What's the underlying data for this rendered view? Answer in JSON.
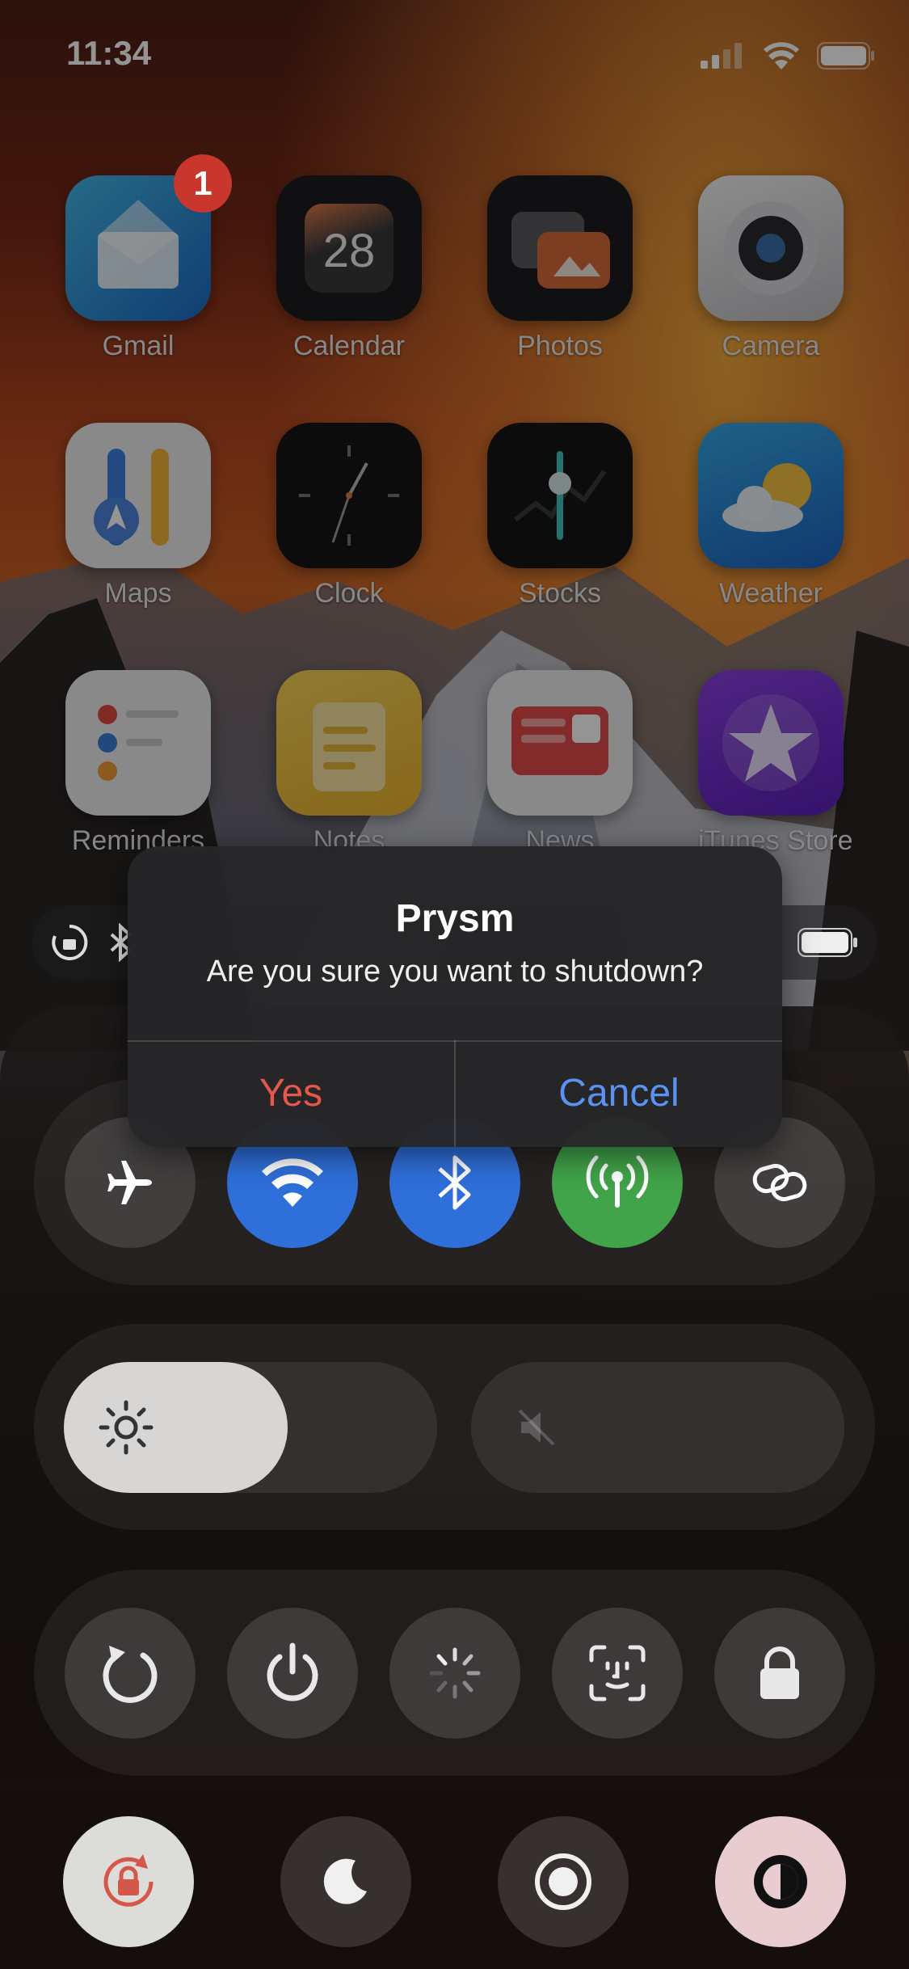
{
  "status_bar": {
    "time": "11:34"
  },
  "apps": [
    {
      "name": "Gmail",
      "badge": "1"
    },
    {
      "name": "Calendar",
      "date": "28"
    },
    {
      "name": "Photos"
    },
    {
      "name": "Camera"
    },
    {
      "name": "Maps"
    },
    {
      "name": "Clock"
    },
    {
      "name": "Stocks"
    },
    {
      "name": "Weather"
    },
    {
      "name": "Reminders"
    },
    {
      "name": "Notes"
    },
    {
      "name": "News"
    },
    {
      "name": "iTunes Store"
    }
  ],
  "alert": {
    "title": "Prysm",
    "message": "Are you sure you want to shutdown?",
    "confirm_label": "Yes",
    "cancel_label": "Cancel",
    "confirm_color": "#e4574a",
    "cancel_color": "#5b92f0"
  },
  "connectivity": {
    "airplane": {
      "icon": "airplane-icon",
      "on": false
    },
    "wifi": {
      "icon": "wifi-icon",
      "on": true,
      "color": "#2f6fda"
    },
    "bluetooth": {
      "icon": "bluetooth-icon",
      "on": true,
      "color": "#2f6fda"
    },
    "cellular": {
      "icon": "antenna-icon",
      "on": true,
      "color": "#41a34a"
    },
    "hotspot": {
      "icon": "link-icon",
      "on": false
    }
  },
  "sliders": {
    "brightness": {
      "icon": "sun-icon",
      "level": 0.6
    },
    "volume": {
      "icon": "speaker-muted-icon",
      "level": 0.0
    }
  },
  "power_actions": [
    {
      "icon": "restart-icon"
    },
    {
      "icon": "power-icon"
    },
    {
      "icon": "spinner-icon"
    },
    {
      "icon": "face-id-icon"
    },
    {
      "icon": "lock-icon"
    }
  ],
  "bottom_toggles": [
    {
      "icon": "rotation-lock-icon",
      "bg": "#dcdcd8"
    },
    {
      "icon": "moon-icon"
    },
    {
      "icon": "record-icon"
    },
    {
      "icon": "dark-mode-icon",
      "bg": "#e8cccf"
    }
  ]
}
